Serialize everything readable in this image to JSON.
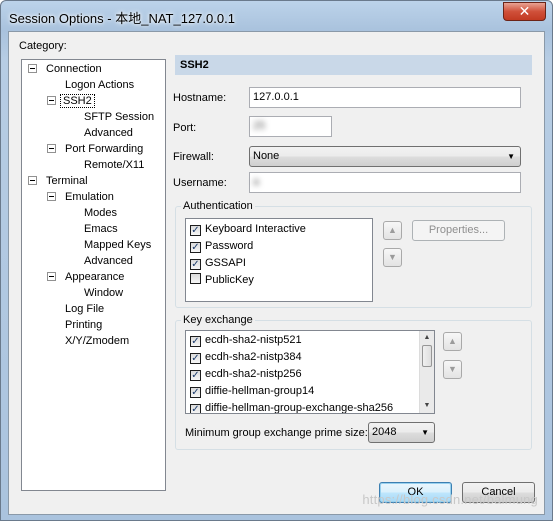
{
  "window": {
    "title": "Session Options - 本地_NAT_127.0.0.1",
    "close_glyph": "✕"
  },
  "category_label": "Category:",
  "tree": {
    "items": [
      {
        "label": "Connection"
      },
      {
        "label": "Logon Actions"
      },
      {
        "label": "SSH2"
      },
      {
        "label": "SFTP Session"
      },
      {
        "label": "Advanced"
      },
      {
        "label": "Port Forwarding"
      },
      {
        "label": "Remote/X11"
      },
      {
        "label": "Terminal"
      },
      {
        "label": "Emulation"
      },
      {
        "label": "Modes"
      },
      {
        "label": "Emacs"
      },
      {
        "label": "Mapped Keys"
      },
      {
        "label": "Advanced"
      },
      {
        "label": "Appearance"
      },
      {
        "label": "Window"
      },
      {
        "label": "Log File"
      },
      {
        "label": "Printing"
      },
      {
        "label": "X/Y/Zmodem"
      }
    ]
  },
  "section_title": "SSH2",
  "form": {
    "hostname_label": "Hostname:",
    "hostname_value": "127.0.0.1",
    "port_label": "Port:",
    "port_value": "25",
    "firewall_label": "Firewall:",
    "firewall_value": "None",
    "username_label": "Username:",
    "username_value": "a"
  },
  "authentication": {
    "legend": "Authentication",
    "items": [
      {
        "label": "Keyboard Interactive",
        "checked": true
      },
      {
        "label": "Password",
        "checked": true
      },
      {
        "label": "GSSAPI",
        "checked": true
      },
      {
        "label": "PublicKey",
        "checked": false
      }
    ],
    "properties_label": "Properties..."
  },
  "key_exchange": {
    "legend": "Key exchange",
    "items": [
      {
        "label": "ecdh-sha2-nistp521",
        "checked": true
      },
      {
        "label": "ecdh-sha2-nistp384",
        "checked": true
      },
      {
        "label": "ecdh-sha2-nistp256",
        "checked": true
      },
      {
        "label": "diffie-hellman-group14",
        "checked": true
      },
      {
        "label": "diffie-hellman-group-exchange-sha256",
        "checked": true
      }
    ],
    "min_prime_label": "Minimum group exchange prime size:",
    "min_prime_value": "2048"
  },
  "buttons": {
    "ok": "OK",
    "cancel": "Cancel"
  },
  "watermark": "https://blog.csdn.net/balmung",
  "icons": {
    "arrow_up": "▲",
    "arrow_down": "▼",
    "check": "✓"
  }
}
